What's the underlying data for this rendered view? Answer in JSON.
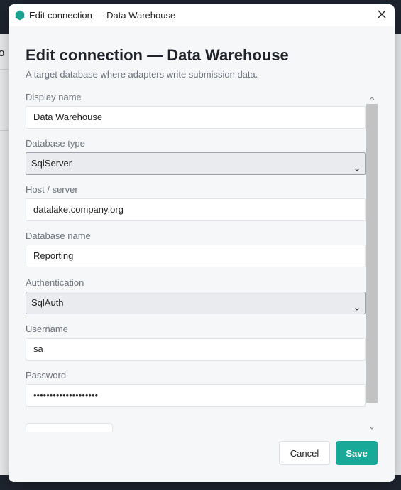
{
  "window": {
    "title": "Edit connection — Data Warehouse"
  },
  "background": {
    "partial_text": "o"
  },
  "dialog": {
    "heading": "Edit connection — Data Warehouse",
    "subheading": "A target database where adapters write submission data."
  },
  "fields": {
    "display_name": {
      "label": "Display name",
      "value": "Data Warehouse"
    },
    "database_type": {
      "label": "Database type",
      "value": "SqlServer"
    },
    "host": {
      "label": "Host / server",
      "value": "datalake.company.org"
    },
    "database_name": {
      "label": "Database name",
      "value": "Reporting"
    },
    "authentication": {
      "label": "Authentication",
      "value": "SqlAuth"
    },
    "username": {
      "label": "Username",
      "value": "sa"
    },
    "password": {
      "label": "Password",
      "value": "••••••••••••••••••••"
    }
  },
  "actions": {
    "cancel_label": "Cancel",
    "save_label": "Save"
  },
  "icons": {
    "app": "hexagon-icon",
    "close": "close-icon",
    "select": "chevron-down-icon",
    "scroll_up": "chevron-up-icon",
    "scroll_down": "chevron-down-icon"
  },
  "colors": {
    "accent": "#18a999",
    "app_icon": "#1aa390"
  }
}
